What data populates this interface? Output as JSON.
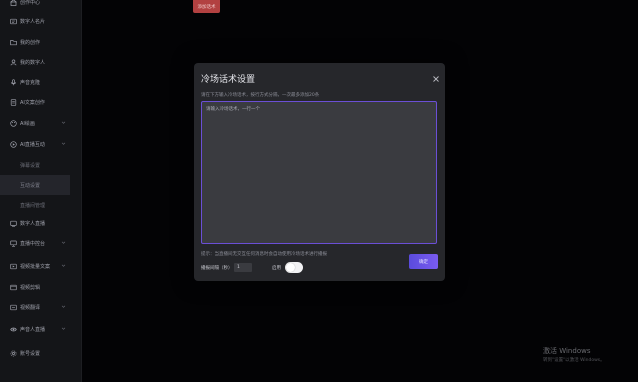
{
  "sidebar": {
    "items": [
      {
        "label": "创作中心",
        "icon": "home-icon"
      },
      {
        "label": "数字人名片",
        "icon": "id-card-icon"
      },
      {
        "label": "我的创作",
        "icon": "folder-icon"
      },
      {
        "label": "我的数字人",
        "icon": "user-icon"
      },
      {
        "label": "声音克隆",
        "icon": "microphone-icon"
      },
      {
        "label": "AI文案创作",
        "icon": "document-icon"
      },
      {
        "label": "AI绘画",
        "icon": "palette-icon"
      },
      {
        "label": "AI直播互动",
        "icon": "live-icon"
      },
      {
        "label": "弹幕设置",
        "sub": true
      },
      {
        "label": "互动设置",
        "sub": true,
        "active": true
      },
      {
        "label": "直播间管理",
        "sub": true
      },
      {
        "label": "数字人直播",
        "icon": "broadcast-icon"
      },
      {
        "label": "直播中控台",
        "icon": "monitor-icon"
      },
      {
        "label": "视频批量文案",
        "icon": "video-text-icon"
      },
      {
        "label": "视频剪辑",
        "icon": "scissors-icon"
      },
      {
        "label": "视频翻译",
        "icon": "translate-icon"
      },
      {
        "label": "声音人直播",
        "icon": "voice-live-icon"
      },
      {
        "label": "账号设置",
        "icon": "gear-icon"
      }
    ]
  },
  "top_button": {
    "label": "添加话术"
  },
  "modal": {
    "title": "冷场话术设置",
    "description": "请在下方输入冷场话术，按行方式分隔，一次最多添加20条",
    "textarea_placeholder": "请输入冷场话术，一行一个",
    "hint": "提示：当直播间无交互任何消息时会自动使用冷场话术进行播报",
    "interval_label": "播报间隔（秒）",
    "interval_value": "1",
    "enable_label": "启用",
    "enabled": true,
    "confirm_label": "确定",
    "accent_color": "#6b4fd6"
  },
  "watermark": {
    "line1": "激活 Windows",
    "line2": "转到\"设置\"以激活 Windows。"
  }
}
